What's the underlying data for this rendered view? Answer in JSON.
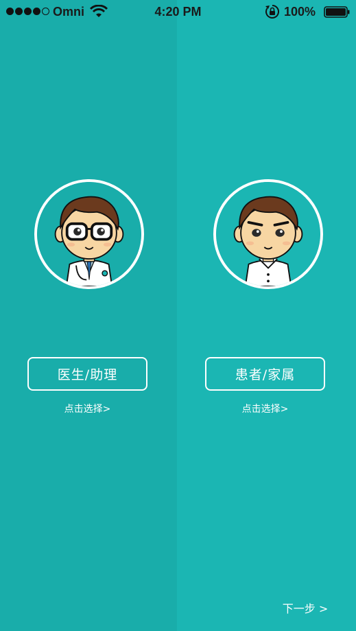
{
  "status_bar": {
    "carrier": "Omni",
    "time": "4:20 PM",
    "battery_pct": "100%"
  },
  "roles": {
    "doctor": {
      "label": "医生/助理",
      "hint": "点击选择>"
    },
    "patient": {
      "label": "患者/家属",
      "hint": "点击选择>"
    }
  },
  "next_label": "下一步 >",
  "colors": {
    "left_bg": "#19adaa",
    "right_bg": "#1bb6b3",
    "accent": "#ffffff"
  }
}
